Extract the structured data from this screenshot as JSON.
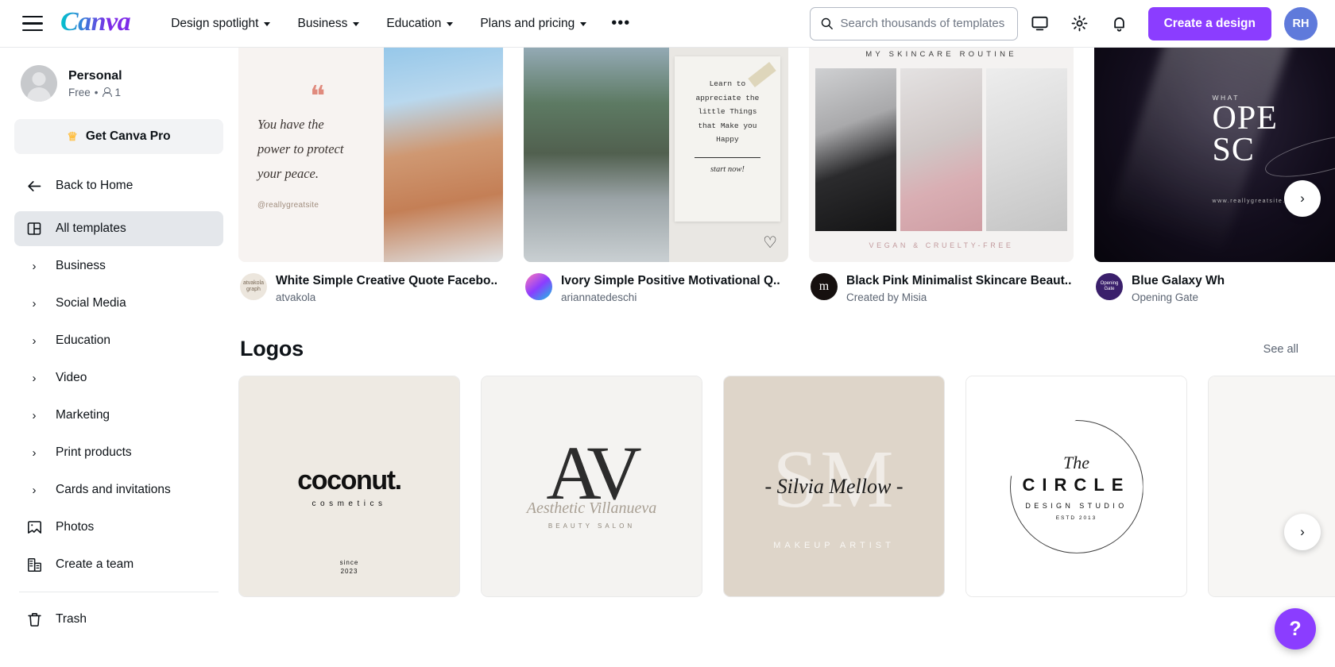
{
  "header": {
    "brand": "Canva",
    "nav": [
      {
        "label": "Design spotlight"
      },
      {
        "label": "Business"
      },
      {
        "label": "Education"
      },
      {
        "label": "Plans and pricing"
      }
    ],
    "more_label": "•••",
    "search": {
      "value": "",
      "placeholder": "Search thousands of templates"
    },
    "icons": [
      "monitor-icon",
      "gear-icon",
      "bell-icon"
    ],
    "cta_label": "Create a design",
    "avatar_initials": "RH",
    "accent_color": "#8b3dff"
  },
  "sidebar": {
    "account": {
      "name": "Personal",
      "plan": "Free",
      "separator": "•",
      "members": "1"
    },
    "pro_button": "Get Canva Pro",
    "back_label": "Back to Home",
    "all_templates": "All templates",
    "categories": [
      {
        "label": "Business"
      },
      {
        "label": "Social Media"
      },
      {
        "label": "Education"
      },
      {
        "label": "Video"
      },
      {
        "label": "Marketing"
      },
      {
        "label": "Print products"
      },
      {
        "label": "Cards and invitations"
      }
    ],
    "links": [
      {
        "label": "Photos",
        "icon": "photo-icon"
      },
      {
        "label": "Create a team",
        "icon": "building-icon"
      }
    ],
    "trash_label": "Trash"
  },
  "templates": [
    {
      "title": "White Simple Creative Quote Facebo..",
      "author": "atvakola",
      "art": {
        "quote_mark": "❝",
        "line1": "You have the",
        "line2": "power to protect",
        "line3": "your peace.",
        "handle": "@reallygreatsite"
      }
    },
    {
      "title": "Ivory Simple Positive Motivational Q..",
      "author": "ariannatedeschi",
      "art": {
        "note_line1": "Learn to",
        "note_line2": "appreciate the",
        "note_line3": "little Things",
        "note_line4": "that Make you",
        "note_line5": "Happy",
        "note_start": "start now!"
      }
    },
    {
      "title": "Black Pink Minimalist Skincare Beaut..",
      "author": "Created by Misia",
      "art": {
        "heading": "MY SKINCARE ROUTINE",
        "footer": "VEGAN & CRUELTY-FREE"
      }
    },
    {
      "title": "Blue Galaxy Wh",
      "author": "Opening Gate",
      "art": {
        "small": "WHAT",
        "big1": "OPE",
        "big2": "SC",
        "url": "www.reallygreatsite.com"
      }
    }
  ],
  "logos_section": {
    "title": "Logos",
    "see_all": "See all",
    "cards": [
      {
        "name": "coconut-cosmetics-logo",
        "word": "coconut.",
        "sub": "cosmetics",
        "year": "since\n2023"
      },
      {
        "name": "aesthetic-villanueva-logo",
        "mono": "AV",
        "sig": "Aesthetic Villanueva",
        "sub": "BEAUTY SALON"
      },
      {
        "name": "silvia-mellow-logo",
        "mono": "SM",
        "sig": "- Silvia Mellow -",
        "sub": "MAKEUP ARTIST"
      },
      {
        "name": "the-circle-logo",
        "the": "The",
        "big": "CIRCLE",
        "sub": "DESIGN STUDIO",
        "est": "ESTD 2013"
      },
      {
        "name": "partial-logo-card"
      }
    ]
  },
  "controls": {
    "next_templates": "›",
    "next_logos": "›",
    "help": "?"
  }
}
